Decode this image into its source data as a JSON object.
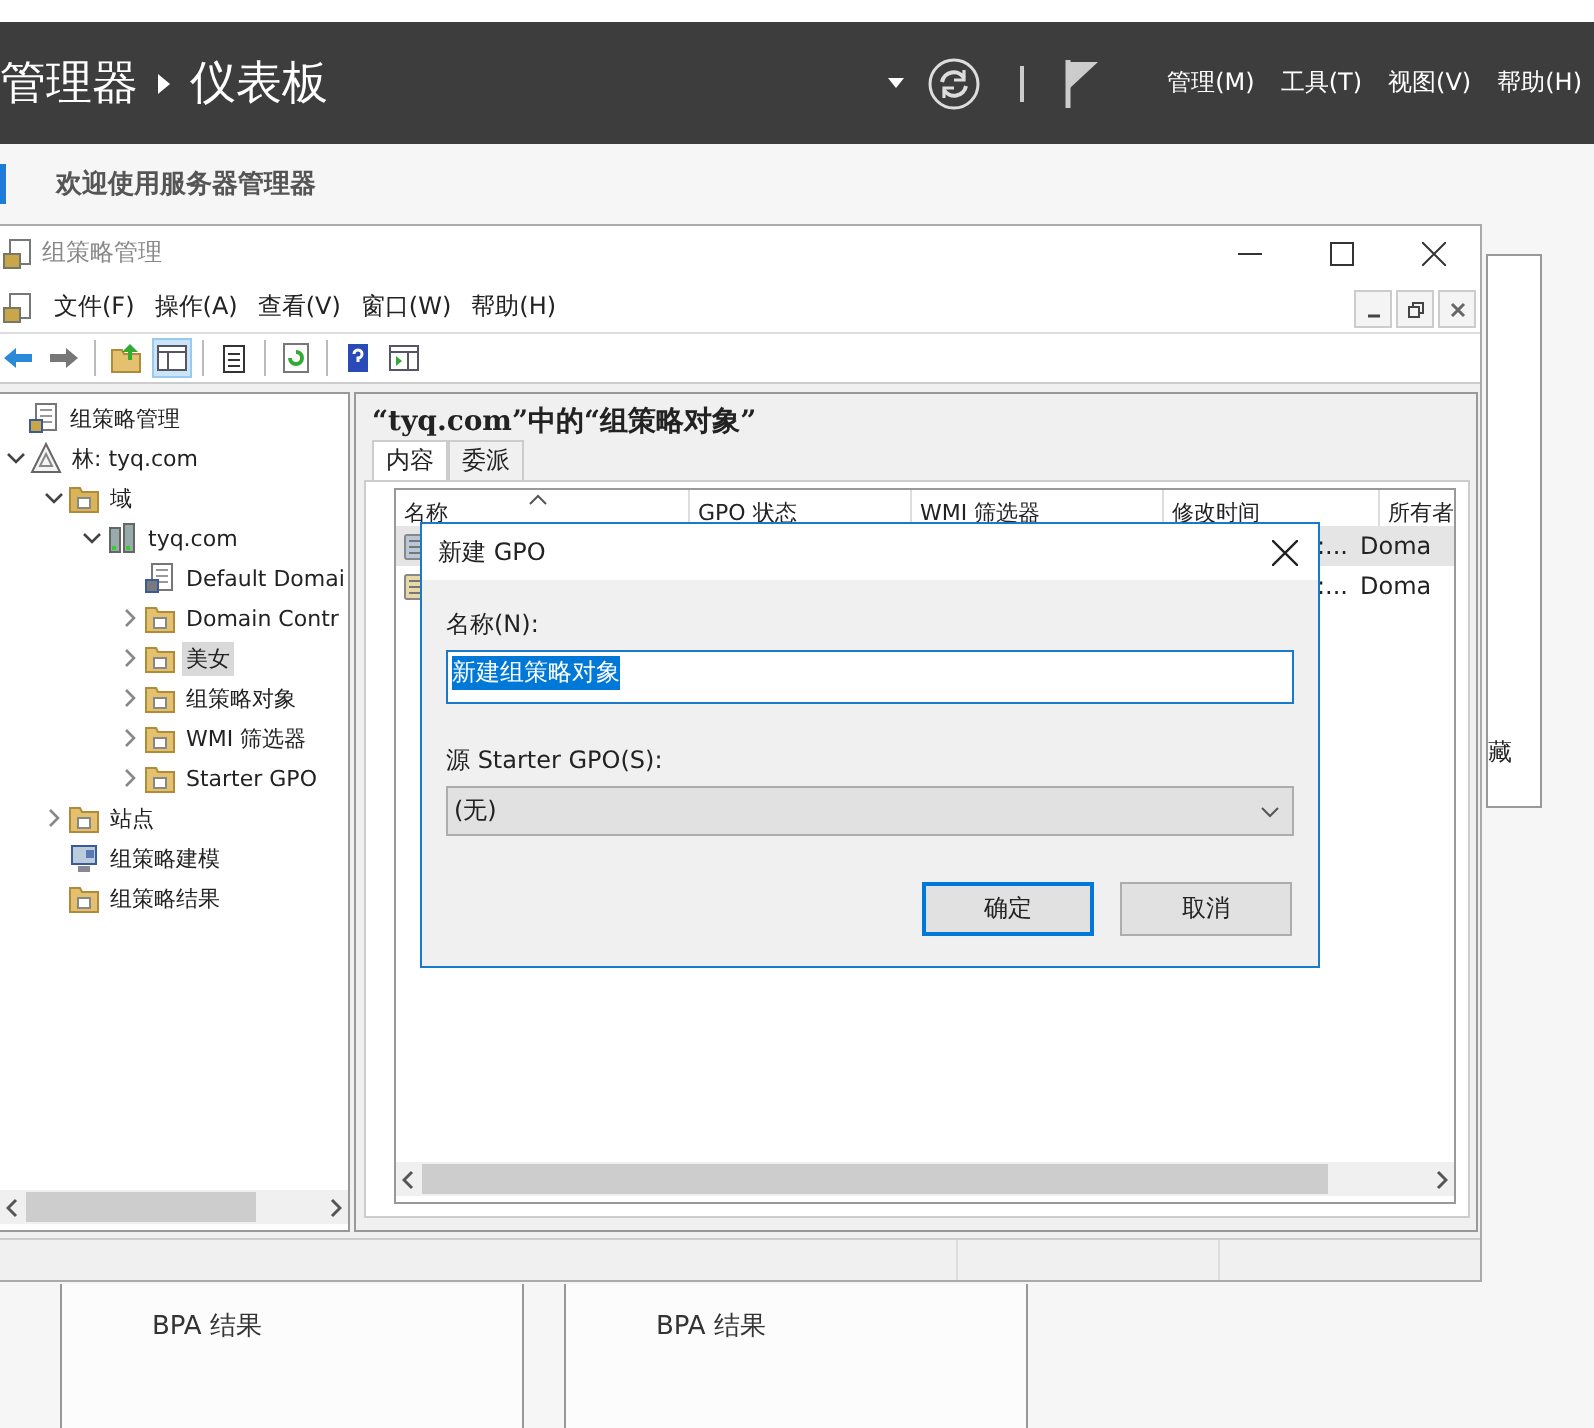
{
  "server_manager": {
    "breadcrumb": [
      "管理器",
      "仪表板"
    ],
    "menus": [
      "管理(M)",
      "工具(T)",
      "视图(V)",
      "帮助(H)"
    ],
    "welcome": "欢迎使用服务器管理器",
    "side_panel_text": "藏",
    "tiles": [
      "BPA 结果",
      "BPA 结果"
    ]
  },
  "gpm_window": {
    "title": "组策略管理",
    "menus": [
      "文件(F)",
      "操作(A)",
      "查看(V)",
      "窗口(W)",
      "帮助(H)"
    ],
    "toolbar": [
      [
        {
          "kind": "back",
          "pressed": false
        },
        {
          "kind": "forward",
          "pressed": false
        }
      ],
      [
        {
          "kind": "up",
          "pressed": false
        },
        {
          "kind": "tree",
          "pressed": true
        }
      ],
      [
        {
          "kind": "clipboard",
          "pressed": false
        }
      ],
      [
        {
          "kind": "refresh",
          "pressed": false
        }
      ],
      [
        {
          "kind": "help",
          "pressed": false
        },
        {
          "kind": "panel",
          "pressed": false
        }
      ]
    ],
    "tree": [
      {
        "label": "组策略管理",
        "kind": "root",
        "selected": false,
        "children": [
          {
            "label": "林: tyq.com",
            "kind": "forest",
            "expanded": true,
            "selected": false,
            "children": [
              {
                "label": "域",
                "kind": "domains",
                "expanded": true,
                "selected": false,
                "children": [
                  {
                    "label": "tyq.com",
                    "kind": "domain",
                    "expanded": true,
                    "selected": false,
                    "children": [
                      {
                        "label": "Default Domai",
                        "kind": "link",
                        "selected": false
                      },
                      {
                        "label": "Domain Contr",
                        "kind": "ou",
                        "expanded": false,
                        "selected": false
                      },
                      {
                        "label": "美女",
                        "kind": "ou",
                        "expanded": false,
                        "selected": true
                      },
                      {
                        "label": "组策略对象",
                        "kind": "gpos",
                        "expanded": false,
                        "selected": false
                      },
                      {
                        "label": "WMI 筛选器",
                        "kind": "wmi",
                        "expanded": false,
                        "selected": false
                      },
                      {
                        "label": "Starter GPO",
                        "kind": "starter",
                        "expanded": false,
                        "selected": false
                      }
                    ]
                  }
                ]
              },
              {
                "label": "站点",
                "kind": "sites",
                "expanded": false,
                "selected": false
              },
              {
                "label": "组策略建模",
                "kind": "modeling",
                "selected": false
              },
              {
                "label": "组策略结果",
                "kind": "results",
                "selected": false
              }
            ]
          }
        ]
      }
    ],
    "heading": "“tyq.com”中的“组策略对象”",
    "tabs": [
      {
        "label": "内容",
        "selected": true
      },
      {
        "label": "委派",
        "selected": false
      }
    ],
    "columns": [
      "名称",
      "GPO 状态",
      "WMI 筛选器",
      "修改时间",
      "所有者"
    ],
    "rows": [
      {
        "column_4": ":...",
        "owner": "Doma",
        "selected": true
      },
      {
        "column_4": ":...",
        "owner": "Doma",
        "selected": false
      }
    ]
  },
  "dialog": {
    "title": "新建 GPO",
    "name_label": "名称(N):",
    "name_value": "新建组策略对象",
    "source_label": "源 Starter GPO(S):",
    "source_value": "(无)",
    "buttons": [
      {
        "label": "确定",
        "default": true
      },
      {
        "label": "取消",
        "default": false
      }
    ]
  }
}
